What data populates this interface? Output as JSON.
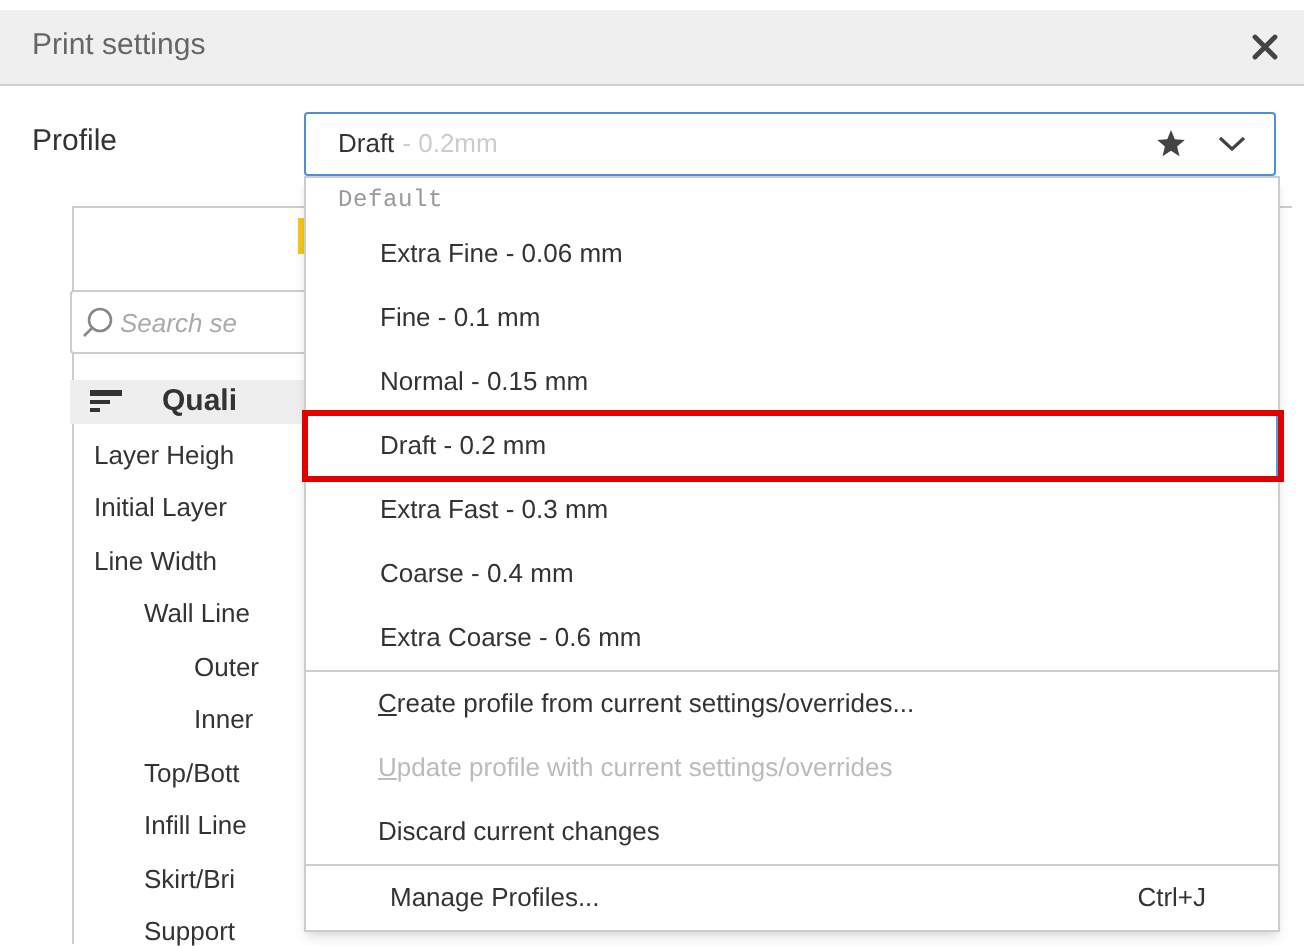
{
  "window": {
    "title": "Print settings"
  },
  "profile": {
    "label": "Profile",
    "value": "Draft",
    "detail": "- 0.2mm"
  },
  "panel": {
    "search": {
      "placeholder": "Search se"
    },
    "category": {
      "label": "Quali"
    },
    "settings": [
      {
        "label": "Layer Heigh"
      },
      {
        "label": "Initial Layer"
      },
      {
        "label": "Line Width",
        "children": [
          {
            "label": "Wall Line",
            "children": [
              {
                "label": "Outer"
              },
              {
                "label": "Inner"
              }
            ]
          },
          {
            "label": "Top/Bott"
          },
          {
            "label": "Infill Line"
          },
          {
            "label": "Skirt/Bri"
          },
          {
            "label": "Support"
          }
        ]
      }
    ]
  },
  "menu": {
    "header": "Default",
    "profiles": [
      {
        "label": "Extra Fine - 0.06 mm",
        "selected": false
      },
      {
        "label": "Fine - 0.1 mm",
        "selected": false
      },
      {
        "label": "Normal - 0.15 mm",
        "selected": false
      },
      {
        "label": "Draft - 0.2 mm",
        "selected": true
      },
      {
        "label": "Extra Fast - 0.3 mm",
        "selected": false
      },
      {
        "label": "Coarse - 0.4 mm",
        "selected": false
      },
      {
        "label": "Extra Coarse - 0.6 mm",
        "selected": false
      }
    ],
    "actions": [
      {
        "label": "Create profile from current settings/overrides...",
        "mnemonic": true,
        "disabled": false
      },
      {
        "label": "Update profile with current settings/overrides",
        "mnemonic": true,
        "disabled": true
      },
      {
        "label": "Discard current changes",
        "mnemonic": false,
        "disabled": false
      }
    ],
    "manage": {
      "label": "Manage Profiles...",
      "shortcut": "Ctrl+J"
    }
  }
}
